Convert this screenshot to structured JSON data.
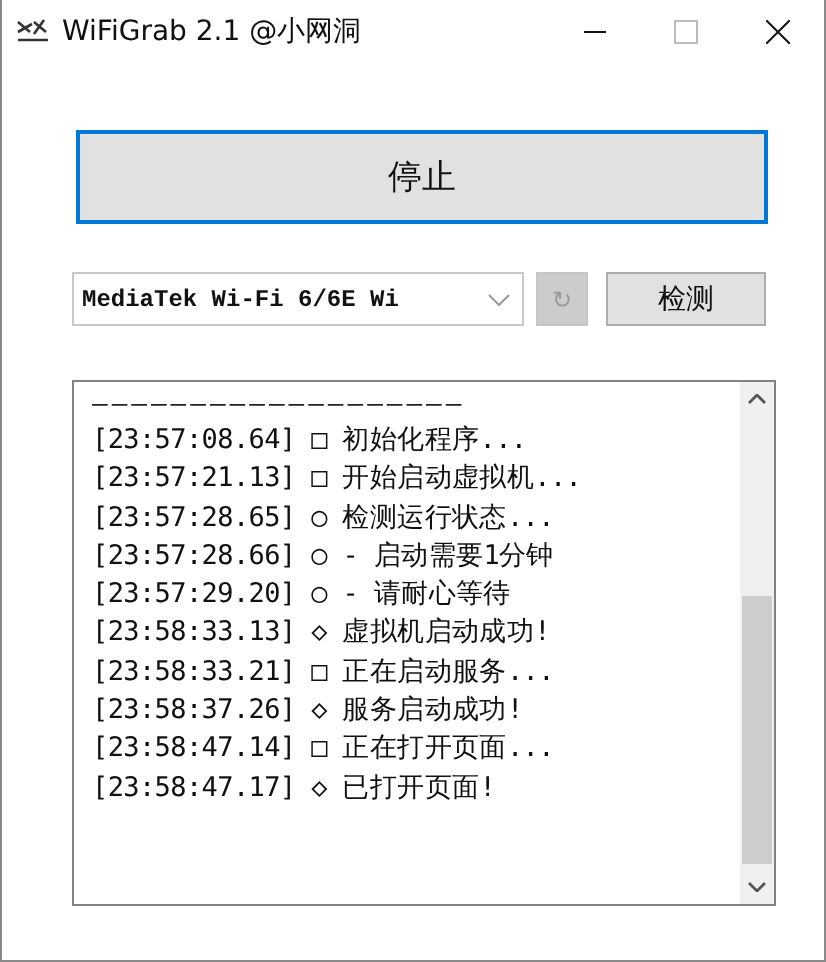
{
  "window": {
    "title": "WiFiGrab 2.1 @小网洞"
  },
  "main_button": {
    "label": "停止"
  },
  "adapter_select": {
    "value": "MediaTek Wi-Fi 6/6E Wi"
  },
  "refresh_button": {
    "label": "↻",
    "disabled": true
  },
  "detect_button": {
    "label": "检测"
  },
  "log": {
    "separator": "———————————————————",
    "lines": [
      {
        "text": "[23:57:08.64] □ 初始化程序..."
      },
      {
        "text": "[23:57:21.13] □ 开始启动虚拟机..."
      },
      {
        "text": "[23:57:28.65] ○ 检测运行状态..."
      },
      {
        "text": "[23:57:28.66] ○ - 启动需要1分钟"
      },
      {
        "text": "[23:57:29.20] ○ - 请耐心等待"
      },
      {
        "text": "[23:58:33.13] ◇ 虚拟机启动成功!"
      },
      {
        "text": "[23:58:33.21] □ 正在启动服务..."
      },
      {
        "text": "[23:58:37.26] ◇ 服务启动成功!"
      },
      {
        "text": "[23:58:47.14] □ 正在打开页面..."
      },
      {
        "text": "[23:58:47.17] ◇ 已打开页面!"
      }
    ]
  }
}
